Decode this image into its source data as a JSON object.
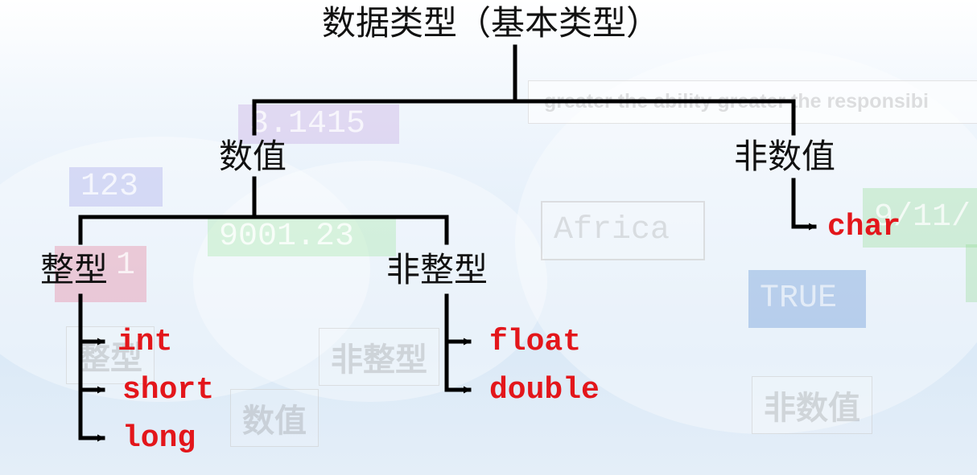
{
  "diagram": {
    "root": "数据类型（基本类型）",
    "numeric": "数值",
    "non_numeric": "非数值",
    "integer": "整型",
    "non_integer": "非整型",
    "integer_types": [
      "int",
      "short",
      "long"
    ],
    "non_integer_types": [
      "float",
      "double"
    ],
    "non_numeric_types": [
      "char"
    ]
  },
  "background": {
    "watermarks": [
      "3.1415",
      "123",
      "9001.23",
      "1",
      "Africa",
      "TRUE",
      "9/11/",
      "整型",
      "非整型",
      "数值",
      "非数值"
    ],
    "banner_text": "greater the ability greater the responsibi"
  },
  "colors": {
    "line": "#000000",
    "leaf_text": "#e3161b",
    "node_text": "#111111"
  }
}
